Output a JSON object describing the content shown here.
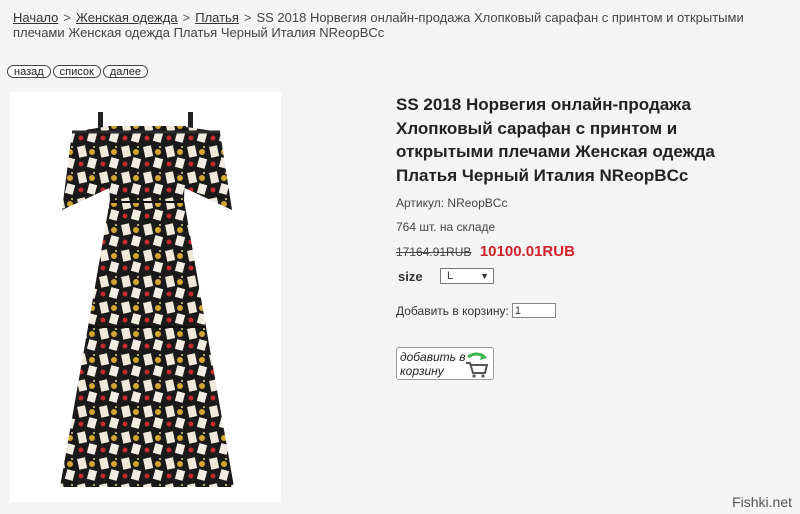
{
  "breadcrumb": {
    "items": [
      "Начало",
      "Женская одежда",
      "Платья"
    ],
    "separator": ">",
    "current": "SS 2018 Норвегия онлайн-продажа Хлопковый сарафан с принтом и открытыми плечами Женская одежда Платья Черный Италия NReopBCc"
  },
  "nav": {
    "back": "назад",
    "list": "список",
    "next": "далее"
  },
  "product": {
    "title": "SS 2018 Норвегия онлайн-продажа Хлопковый сарафан с принтом и открытыми плечами Женская одежда Платья Черный Италия NReopBCc",
    "sku_label": "Артикул:",
    "sku": "NReopBCc",
    "stock": "764 шт. на складе",
    "old_price": "17164.91RUB",
    "new_price": "10100.01RUB",
    "size_label": "size",
    "size_selected": "L",
    "qty_label": "Добавить в корзину:",
    "qty_value": "1",
    "cart_button": "добавить в корзину"
  },
  "watermark": "Fishki.net",
  "colors": {
    "price_red": "#d1212a",
    "background": "#f4f4f4"
  },
  "icons": {
    "cart": "shopping-cart-icon",
    "arrow": "green-arrow-icon"
  }
}
